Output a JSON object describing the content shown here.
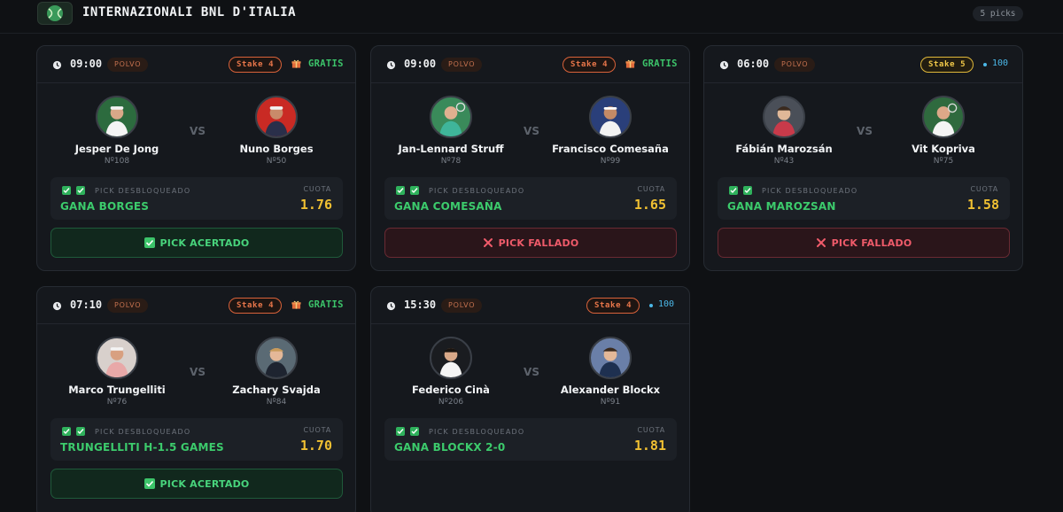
{
  "header": {
    "tournament": "INTERNAZIONALI BNL D'ITALIA",
    "picks_count": "5 picks",
    "logo_icon": "tennis-ball-logo-icon"
  },
  "labels": {
    "vs": "VS",
    "unlocked": "PICK DESBLOQUEADO",
    "cuota": "CUOTA",
    "gratis": "GRATIS"
  },
  "colors": {
    "win": "#48d47c",
    "lose": "#ef5b6a",
    "odds": "#f0c032",
    "pick": "#3ccb6c",
    "stake": "#e8764a",
    "stake_high": "#f0c848",
    "points": "#4bb8e8"
  },
  "cards": [
    {
      "time": "09:00",
      "surface": "POLVO",
      "stake": "Stake 4",
      "stake_style": "orange",
      "access": "gratis",
      "access_label": "GRATIS",
      "p1": {
        "name": "Jesper De Jong",
        "rank": "Nº108"
      },
      "p2": {
        "name": "Nuno Borges",
        "rank": "Nº50"
      },
      "pick": "GANA BORGES",
      "odds": "1.76",
      "result": "win",
      "result_label": "PICK ACERTADO"
    },
    {
      "time": "09:00",
      "surface": "POLVO",
      "stake": "Stake 4",
      "stake_style": "orange",
      "access": "gratis",
      "access_label": "GRATIS",
      "p1": {
        "name": "Jan-Lennard Struff",
        "rank": "Nº78"
      },
      "p2": {
        "name": "Francisco Comesaña",
        "rank": "Nº99"
      },
      "pick": "GANA COMESAÑA",
      "odds": "1.65",
      "result": "lose",
      "result_label": "PICK FALLADO"
    },
    {
      "time": "06:00",
      "surface": "POLVO",
      "stake": "Stake 5",
      "stake_style": "yellow",
      "access": "points",
      "access_label": "100",
      "p1": {
        "name": "Fábián Marozsán",
        "rank": "Nº43"
      },
      "p2": {
        "name": "Vit Kopriva",
        "rank": "Nº75"
      },
      "pick": "GANA MAROZSAN",
      "odds": "1.58",
      "result": "lose",
      "result_label": "PICK FALLADO"
    },
    {
      "time": "07:10",
      "surface": "POLVO",
      "stake": "Stake 4",
      "stake_style": "orange",
      "access": "gratis",
      "access_label": "GRATIS",
      "p1": {
        "name": "Marco Trungelliti",
        "rank": "Nº76"
      },
      "p2": {
        "name": "Zachary Svajda",
        "rank": "Nº84"
      },
      "pick": "TRUNGELLITI H-1.5 GAMES",
      "odds": "1.70",
      "result": "win",
      "result_label": "PICK ACERTADO"
    },
    {
      "time": "15:30",
      "surface": "POLVO",
      "stake": "Stake 4",
      "stake_style": "orange",
      "access": "points",
      "access_label": "100",
      "p1": {
        "name": "Federico Cinà",
        "rank": "Nº206"
      },
      "p2": {
        "name": "Alexander Blockx",
        "rank": "Nº91"
      },
      "pick": "GANA BLOCKX 2-0",
      "odds": "1.81",
      "result": "none",
      "result_label": ""
    }
  ]
}
